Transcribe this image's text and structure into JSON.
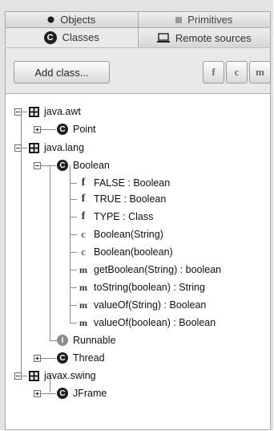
{
  "tabs": {
    "objects": "Objects",
    "primitives": "Primitives",
    "classes": "Classes",
    "remote": "Remote sources"
  },
  "toolbar": {
    "add_class": "Add class...",
    "filter_f": "f",
    "filter_c": "c",
    "filter_m": "m"
  },
  "tree": {
    "pkg_awt": "java.awt",
    "point": "Point",
    "pkg_lang": "java.lang",
    "boolean": "Boolean",
    "f_false": "FALSE : Boolean",
    "f_true": "TRUE : Boolean",
    "f_type": "TYPE : Class",
    "c_string": "Boolean(String)",
    "c_boolean": "Boolean(boolean)",
    "m_getboolean": "getBoolean(String) : boolean",
    "m_tostring": "toString(boolean) : String",
    "m_valueof_string": "valueOf(String) : Boolean",
    "m_valueof_boolean": "valueOf(boolean) : Boolean",
    "runnable": "Runnable",
    "thread": "Thread",
    "pkg_swing": "javax.swing",
    "jframe": "JFrame"
  }
}
